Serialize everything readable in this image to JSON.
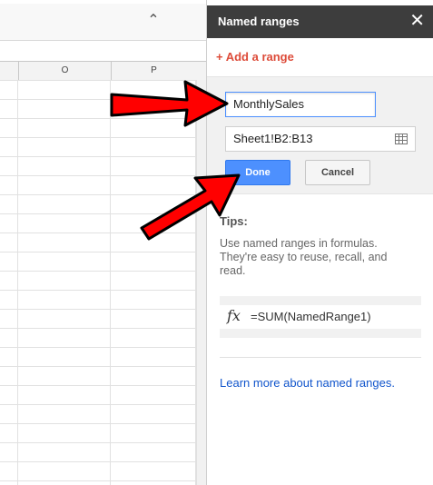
{
  "sheet": {
    "collapse_icon": "double-chevron-up-icon",
    "columns": [
      "O",
      "P"
    ]
  },
  "panel": {
    "title": "Named ranges",
    "close_icon": "close-icon",
    "add_range_label": "+ Add a range",
    "name_value": "MonthlySales",
    "range_value": "Sheet1!B2:B13",
    "range_picker_icon": "grid-icon",
    "done_label": "Done",
    "cancel_label": "Cancel",
    "tips_title": "Tips:",
    "tips_text": "Use named ranges in formulas. They're easy to reuse, recall, and read.",
    "formula_icon": "fx-icon",
    "formula_icon_text": "fx",
    "formula_example": "=SUM(NamedRange1)",
    "learn_more": "Learn more about named ranges."
  },
  "colors": {
    "accent_red": "#dd4b39",
    "done_blue": "#4d90fe",
    "link_blue": "#1155cc",
    "header_dark": "#3d3d3d",
    "annotation_arrow": "#ff0000"
  }
}
